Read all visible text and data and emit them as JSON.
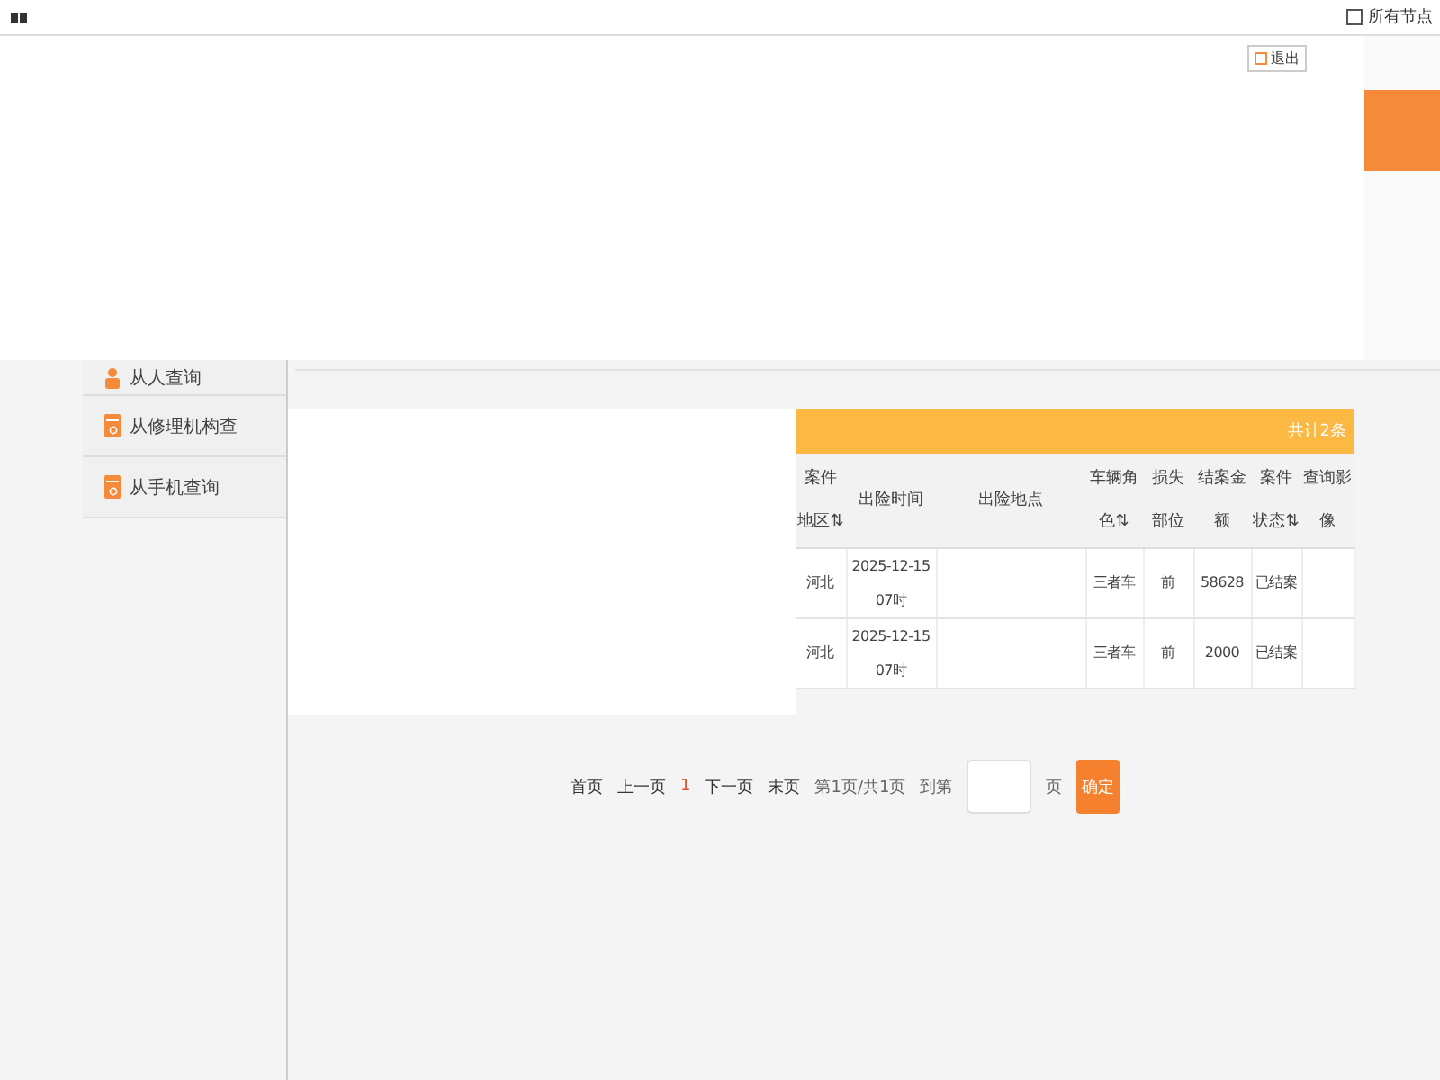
{
  "header": {
    "node_filter": {
      "label": "所有节点",
      "checked": false
    },
    "logout": "退出"
  },
  "sidebar": {
    "items": [
      {
        "label": "从人查询",
        "kind": "person",
        "selected": false
      },
      {
        "label": "从修理机构查",
        "kind": "doc",
        "selected": false
      },
      {
        "label": "从手机查询",
        "kind": "doc",
        "selected": false
      }
    ]
  },
  "table": {
    "total": "共计2条",
    "columns": [
      "案件地区⇅",
      "出险时间",
      "出险地点",
      "车辆角色⇅",
      "损失部位",
      "结案金额",
      "案件状态⇅",
      "查询影像"
    ],
    "rows": [
      [
        "河北",
        "2025-12-15 07时",
        "",
        "三者车",
        "前",
        "58628",
        "已结案",
        ""
      ],
      [
        "河北",
        "2025-12-15 07时",
        "",
        "三者车",
        "前",
        "2000",
        "已结案",
        ""
      ]
    ]
  },
  "pagination": {
    "first": "首页",
    "prev": "上一页",
    "current": "1",
    "next": "下一页",
    "last": "末页",
    "info": "第1页/共1页",
    "goto": "到第",
    "unit": "页",
    "confirm": "确定"
  }
}
